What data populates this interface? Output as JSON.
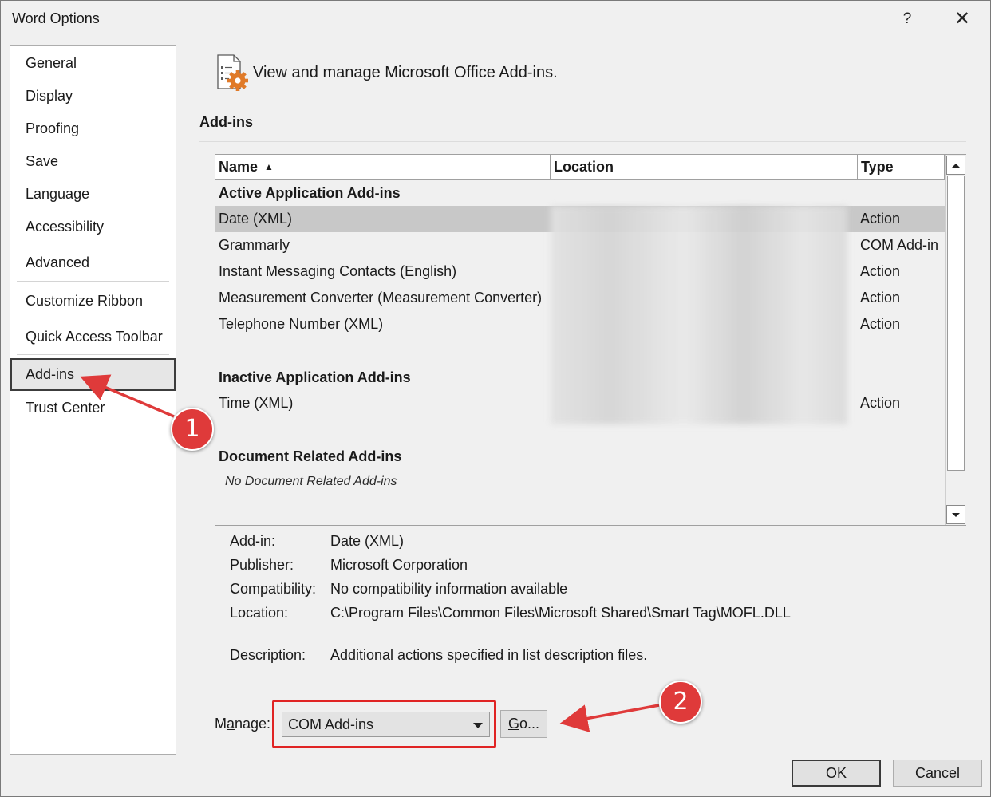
{
  "window": {
    "title": "Word Options",
    "help_glyph": "?",
    "close_glyph": "✕"
  },
  "sidebar": {
    "items": [
      {
        "label": "General"
      },
      {
        "label": "Display"
      },
      {
        "label": "Proofing"
      },
      {
        "label": "Save"
      },
      {
        "label": "Language"
      },
      {
        "label": "Accessibility"
      },
      {
        "label": "Advanced"
      },
      {
        "label": "Customize Ribbon"
      },
      {
        "label": "Quick Access Toolbar"
      },
      {
        "label": "Add-ins",
        "selected": true
      },
      {
        "label": "Trust Center"
      }
    ]
  },
  "main": {
    "header_text": "View and manage Microsoft Office Add-ins.",
    "section_title": "Add-ins",
    "columns": {
      "name": "Name",
      "sort_glyph": "▲",
      "location": "Location",
      "type": "Type"
    },
    "groups": {
      "active": "Active Application Add-ins",
      "inactive": "Inactive Application Add-ins",
      "document": "Document Related Add-ins",
      "document_empty": "No Document Related Add-ins"
    },
    "rows": [
      {
        "name": "Date (XML)",
        "type": "Action",
        "selected": true
      },
      {
        "name": "Grammarly",
        "type": "COM Add-in"
      },
      {
        "name": "Instant Messaging Contacts (English)",
        "type": "Action"
      },
      {
        "name": "Measurement Converter (Measurement Converter)",
        "type": "Action"
      },
      {
        "name": "Telephone Number (XML)",
        "type": "Action"
      },
      {
        "name": "Time (XML)",
        "type": "Action"
      }
    ],
    "details": {
      "addin_label": "Add-in:",
      "addin_value": "Date (XML)",
      "publisher_label": "Publisher:",
      "publisher_value": "Microsoft Corporation",
      "compat_label": "Compatibility:",
      "compat_value": "No compatibility information available",
      "location_label": "Location:",
      "location_value": "C:\\Program Files\\Common Files\\Microsoft Shared\\Smart Tag\\MOFL.DLL",
      "description_label": "Description:",
      "description_value": "Additional actions specified in list description files."
    },
    "manage": {
      "label_prefix": "M",
      "label_underlined": "a",
      "label_rest": "nage:",
      "selected": "COM Add-ins",
      "go_underlined": "G",
      "go_rest": "o..."
    }
  },
  "buttons": {
    "ok": "OK",
    "cancel": "Cancel"
  },
  "annotations": {
    "badge_1": "1",
    "badge_2": "2",
    "color": "#df3a3a"
  }
}
